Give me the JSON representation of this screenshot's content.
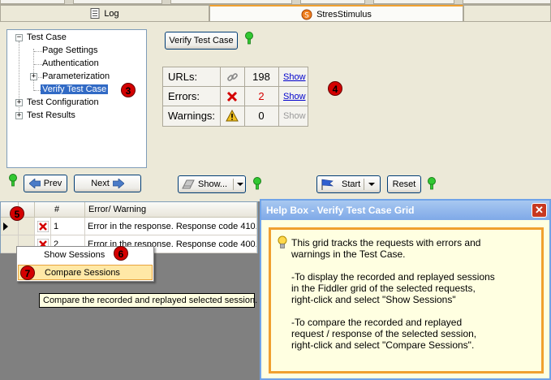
{
  "tabs": {
    "log": "Log",
    "stresstimulus": "StresStimulus"
  },
  "tree": {
    "nodes": [
      {
        "label": "Test Case"
      },
      {
        "label": "Page Settings"
      },
      {
        "label": "Authentication"
      },
      {
        "label": "Parameterization"
      },
      {
        "label": "Verify Test Case"
      },
      {
        "label": "Test Configuration"
      },
      {
        "label": "Test Results"
      }
    ],
    "expand_symbols": {
      "collapse": "−",
      "expand": "+"
    }
  },
  "verify_button": "Verify Test Case",
  "stats": {
    "rows": [
      {
        "label": "URLs:",
        "icon": "chain-link-icon",
        "value": "198",
        "action": "Show",
        "value_color": "#000000"
      },
      {
        "label": "Errors:",
        "icon": "red-x-icon",
        "value": "2",
        "action": "Show",
        "value_color": "#D40000"
      },
      {
        "label": "Warnings:",
        "icon": "warning-triangle-icon",
        "value": "0",
        "action": "Show",
        "value_color": "#000000"
      }
    ]
  },
  "badges": {
    "b3": "3",
    "b4": "4",
    "b5": "5",
    "b6": "6",
    "b7": "7"
  },
  "nav": {
    "prev": "Prev",
    "next": "Next"
  },
  "toolbar": {
    "show": "Show...",
    "start": "Start",
    "reset": "Reset"
  },
  "grid": {
    "columns": [
      "#",
      "Error/ Warning"
    ],
    "rows": [
      {
        "num": "1",
        "text": "Error in the response. Response code 410."
      },
      {
        "num": "2",
        "text": "Error in the response. Response code 400."
      }
    ]
  },
  "context_menu": {
    "show_sessions": "Show Sessions",
    "compare_sessions": "Compare Sessions"
  },
  "tooltip": "Compare the recorded and replayed selected session.",
  "help": {
    "title": "Help Box - Verify Test Case Grid",
    "close": "✕",
    "lines": [
      "This grid tracks the requests with errors and",
      "warnings in the Test Case.",
      "-To display the recorded and replayed sessions",
      "in the Fiddler grid of the selected requests,",
      "right-click and select \"Show Sessions\"",
      "-To compare the recorded and replayed",
      "request / response of the selected session,",
      "right-click and select \"Compare Sessions\"."
    ]
  },
  "colors": {
    "accent_orange": "#F0A030",
    "selection_blue": "#316AC5",
    "badge_red": "#D40000",
    "help_bg": "#FFFFE1",
    "bulb_green": "#32C832"
  }
}
